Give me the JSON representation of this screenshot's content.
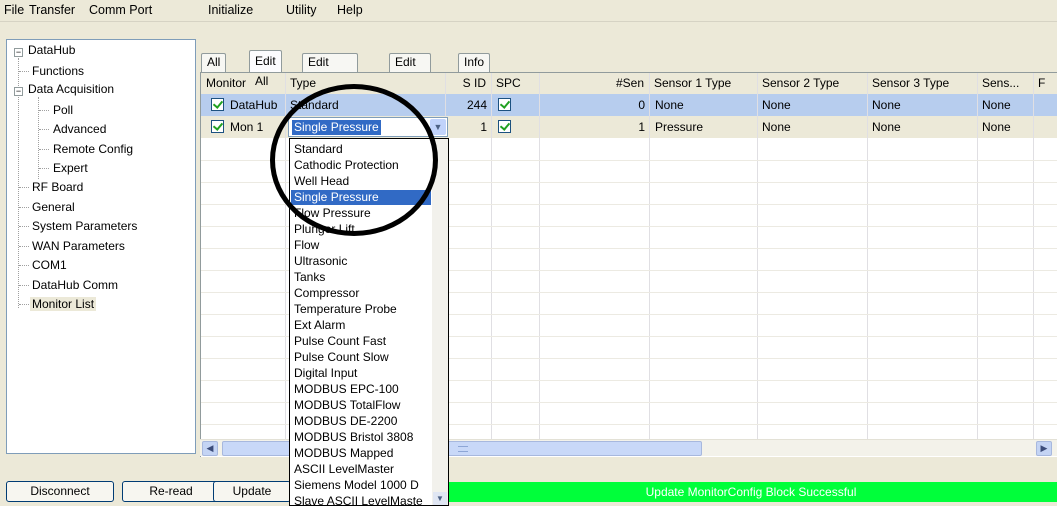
{
  "menu": [
    {
      "label": "File"
    },
    {
      "label": "Transfer"
    },
    {
      "label": "Comm Port"
    },
    {
      "label": "Initialize"
    },
    {
      "label": "Utility"
    },
    {
      "label": "Help"
    }
  ],
  "tree": {
    "root": "DataHub",
    "functions": "Functions",
    "data_acquisition": "Data Acquisition",
    "poll": "Poll",
    "advanced": "Advanced",
    "remote_config": "Remote Config",
    "expert": "Expert",
    "rf_board": "RF Board",
    "general": "General",
    "system_parameters": "System Parameters",
    "wan_parameters": "WAN Parameters",
    "com1": "COM1",
    "datahub_comm": "DataHub Comm",
    "monitor_list": "Monitor List"
  },
  "tabs": [
    "All",
    "Edit All",
    "Edit Sensors",
    "Edit Other",
    "Info"
  ],
  "grid": {
    "columns": [
      "Monitor",
      "Type",
      "S ID",
      "SPC",
      "#Sen",
      "Sensor 1 Type",
      "Sensor 2 Type",
      "Sensor 3 Type",
      "Sens...",
      "F"
    ],
    "rows": [
      {
        "monitor": "DataHub",
        "type": "Standard",
        "sid": "244",
        "sen": "0",
        "s1": "None",
        "s2": "None",
        "s3": "None",
        "s4": "None"
      },
      {
        "monitor": "Mon 1",
        "type": "Single Pressure",
        "sid": "1",
        "sen": "1",
        "s1": "Pressure",
        "s2": "None",
        "s3": "None",
        "s4": "None"
      }
    ]
  },
  "dropdown_options": [
    "Standard",
    "Cathodic Protection",
    "Well Head",
    "Single Pressure",
    "Flow Pressure",
    "Plunger Lift",
    "Flow",
    "Ultrasonic",
    "Tanks",
    "Compressor",
    "Temperature Probe",
    "Ext Alarm",
    "Pulse Count Fast",
    "Pulse Count Slow",
    "Digital Input",
    "MODBUS EPC-100",
    "MODBUS TotalFlow",
    "MODBUS DE-2200",
    "MODBUS Bristol 3808",
    "MODBUS Mapped",
    "ASCII LevelMaster",
    "Siemens Model 1000 D",
    "Slave ASCII LevelMaste"
  ],
  "buttons": {
    "disconnect": "Disconnect",
    "reread": "Re-read",
    "update": "Update"
  },
  "status_text": "Update MonitorConfig Block Successful",
  "colors": {
    "status_bg": "#00ff3a",
    "selection": "#316ac5",
    "selected_row": "#b7cdee"
  }
}
